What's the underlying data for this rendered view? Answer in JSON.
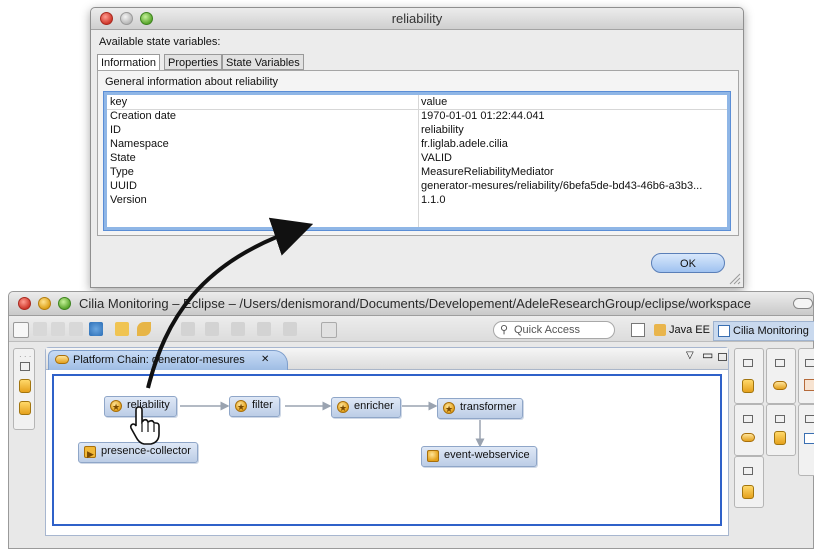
{
  "dialog": {
    "title": "reliability",
    "available_label": "Available state variables:",
    "tabs": [
      "Information",
      "Properties",
      "State Variables"
    ],
    "section_label": "General information about reliability",
    "table": {
      "headers": [
        "key",
        "value"
      ],
      "rows": [
        {
          "key": "Creation date",
          "value": "1970-01-01 01:22:44.041"
        },
        {
          "key": "ID",
          "value": "reliability"
        },
        {
          "key": "Namespace",
          "value": "fr.liglab.adele.cilia"
        },
        {
          "key": "State",
          "value": "VALID"
        },
        {
          "key": "Type",
          "value": "MeasureReliabilityMediator"
        },
        {
          "key": "UUID",
          "value": "generator-mesures/reliability/6befa5de-bd43-46b6-a3b3..."
        },
        {
          "key": "Version",
          "value": "1.1.0"
        }
      ]
    },
    "ok_label": "OK"
  },
  "eclipse": {
    "title": "Cilia Monitoring – Eclipse – /Users/denismorand/Documents/Developement/AdeleResearchGroup/eclipse/workspace",
    "quick_access_placeholder": "Quick Access",
    "perspectives": [
      "Java EE",
      "Cilia Monitoring"
    ],
    "editor_tab": "Platform Chain: generator-mesures",
    "editor_tab_close": "✕",
    "nodes": [
      {
        "id": "reliability",
        "label": "reliability"
      },
      {
        "id": "filter",
        "label": "filter"
      },
      {
        "id": "enricher",
        "label": "enricher"
      },
      {
        "id": "transformer",
        "label": "transformer"
      },
      {
        "id": "presence-collector",
        "label": "presence-collector"
      },
      {
        "id": "event-webservice",
        "label": "event-webservice"
      }
    ]
  },
  "colors": {
    "selection_border": "#2f61c9",
    "table_focus": "#8fb6e6",
    "node_fill": "#c9d8ee"
  },
  "icons": [
    "close-icon",
    "minimize-icon",
    "zoom-icon",
    "search-icon",
    "open-perspective-icon",
    "cilia-icon",
    "hand-cursor-icon",
    "arrow-annotation"
  ]
}
